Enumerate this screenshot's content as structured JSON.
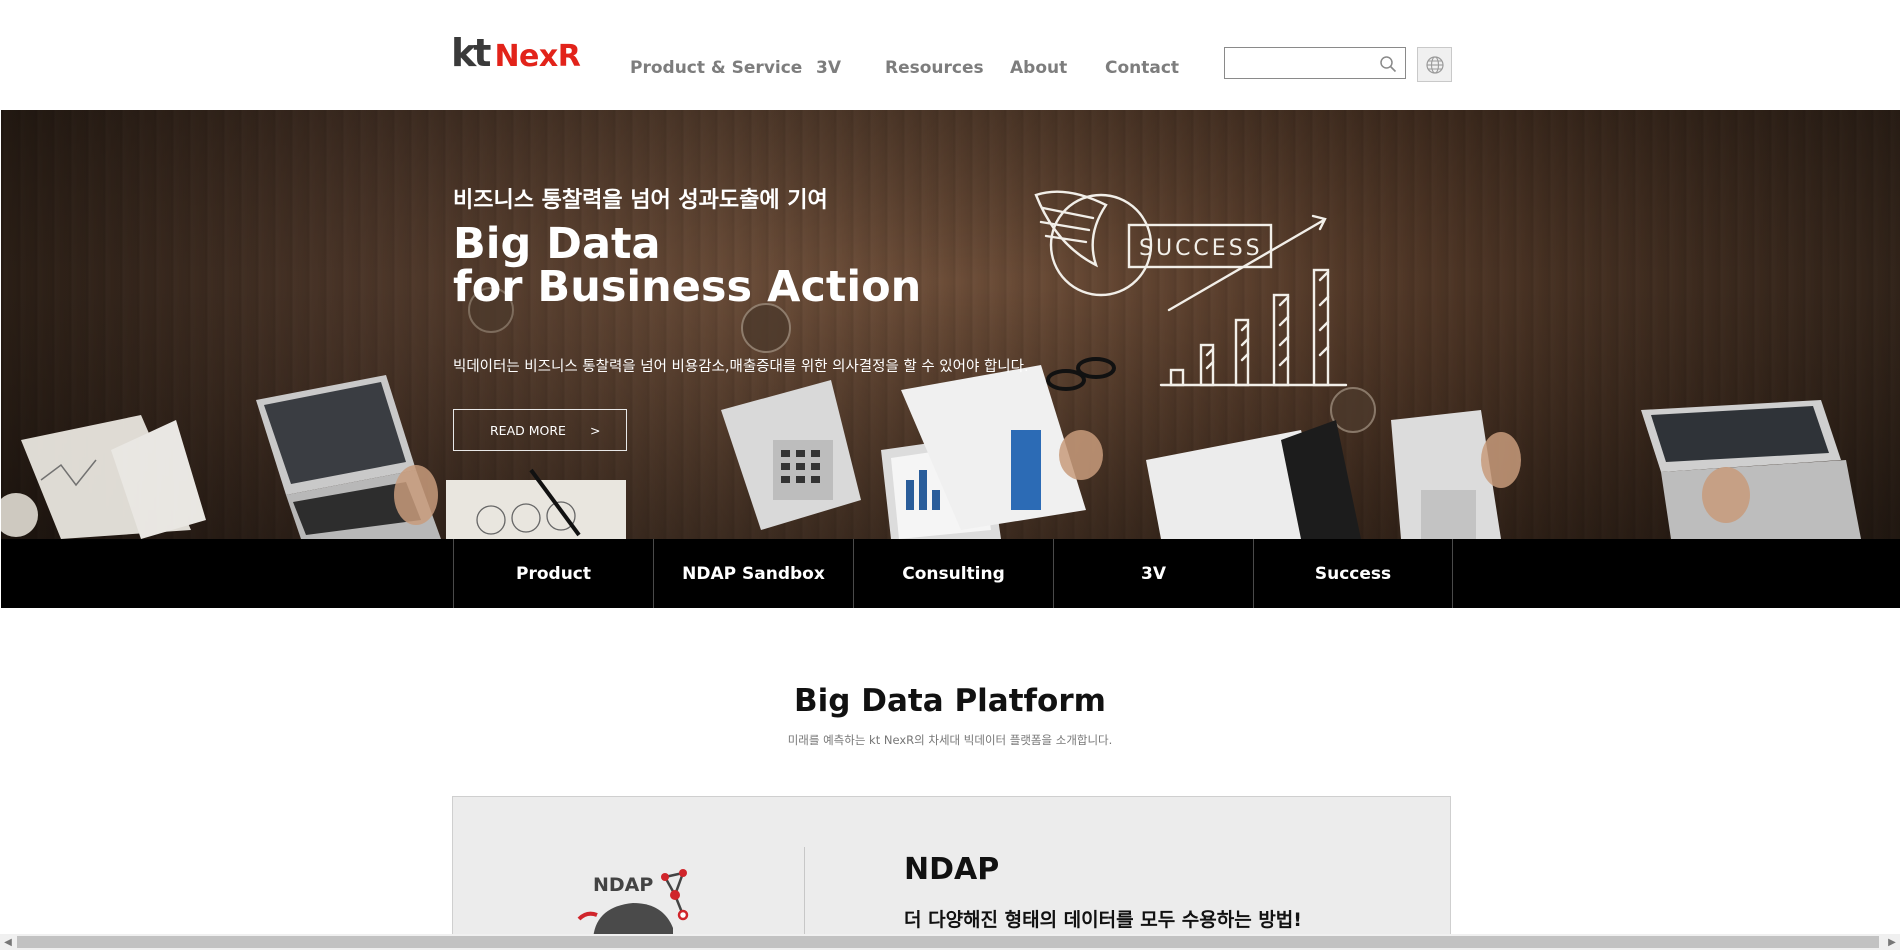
{
  "header": {
    "logo": {
      "kt": "kt",
      "brand": "NexR"
    },
    "nav": [
      "Product & Service",
      "3V",
      "Resources",
      "About",
      "Contact"
    ],
    "search": {
      "placeholder": "",
      "value": "",
      "icon": "search-icon"
    },
    "language_icon": "globe-icon"
  },
  "hero": {
    "subtitle": "비즈니스 통찰력을 넘어 성과도출에 기여",
    "title_line1": "Big Data",
    "title_line2": "for Business Action",
    "description": "빅데이터는 비즈니스 통찰력을 넘어 비용감소,매출증대를 위한 의사결정을 할 수 있어야 합니다.",
    "button_label": "READ MORE",
    "button_arrow": ">",
    "chalk_text": "SUCCESS"
  },
  "tabs": [
    "Product",
    "NDAP Sandbox",
    "Consulting",
    "3V",
    "Success"
  ],
  "section": {
    "title": "Big Data Platform",
    "subtitle": "미래를 예측하는 kt NexR의 차세대 빅데이터 플랫폼을 소개합니다.",
    "card": {
      "logo_text": "NDAP",
      "title": "NDAP",
      "description": "더 다양해진 형태의 데이터를 모두 수용하는 방법!"
    }
  },
  "colors": {
    "brand_red": "#e2231a",
    "nav_gray": "#7d7d7d",
    "tabbar_bg": "#000000",
    "card_bg": "#ececec"
  }
}
